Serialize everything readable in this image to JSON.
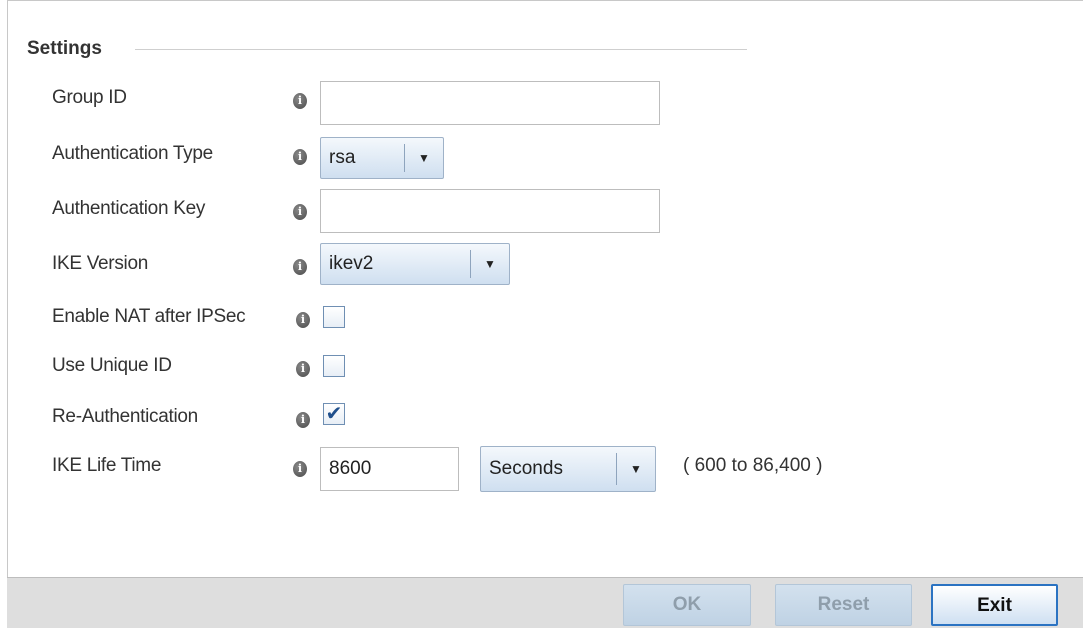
{
  "section": {
    "title": "Settings"
  },
  "fields": {
    "group_id": {
      "label": "Group ID",
      "value": ""
    },
    "auth_type": {
      "label": "Authentication Type",
      "value": "rsa"
    },
    "auth_key": {
      "label": "Authentication Key",
      "value": ""
    },
    "ike_version": {
      "label": "IKE Version",
      "value": "ikev2"
    },
    "nat_after_ipsec": {
      "label": "Enable NAT after IPSec",
      "checked": false
    },
    "unique_id": {
      "label": "Use Unique ID",
      "checked": false
    },
    "re_auth": {
      "label": "Re-Authentication",
      "checked": true,
      "mark": "✔"
    },
    "ike_life_time": {
      "label": "IKE Life Time",
      "value": "8600",
      "unit": "Seconds",
      "range": "( 600 to 86,400 )"
    }
  },
  "info_glyph": "i",
  "icons": {
    "info": "info-icon",
    "dropdown": "dropdown-arrow-icon",
    "check": "checkmark-icon"
  },
  "dropdown_glyph": "▼",
  "footer": {
    "ok_label": "OK",
    "reset_label": "Reset",
    "exit_label": "Exit"
  },
  "colors": {
    "primary_border": "#2b73c2",
    "disabled_text": "#8f9eab",
    "footer_bg": "#dedede"
  }
}
